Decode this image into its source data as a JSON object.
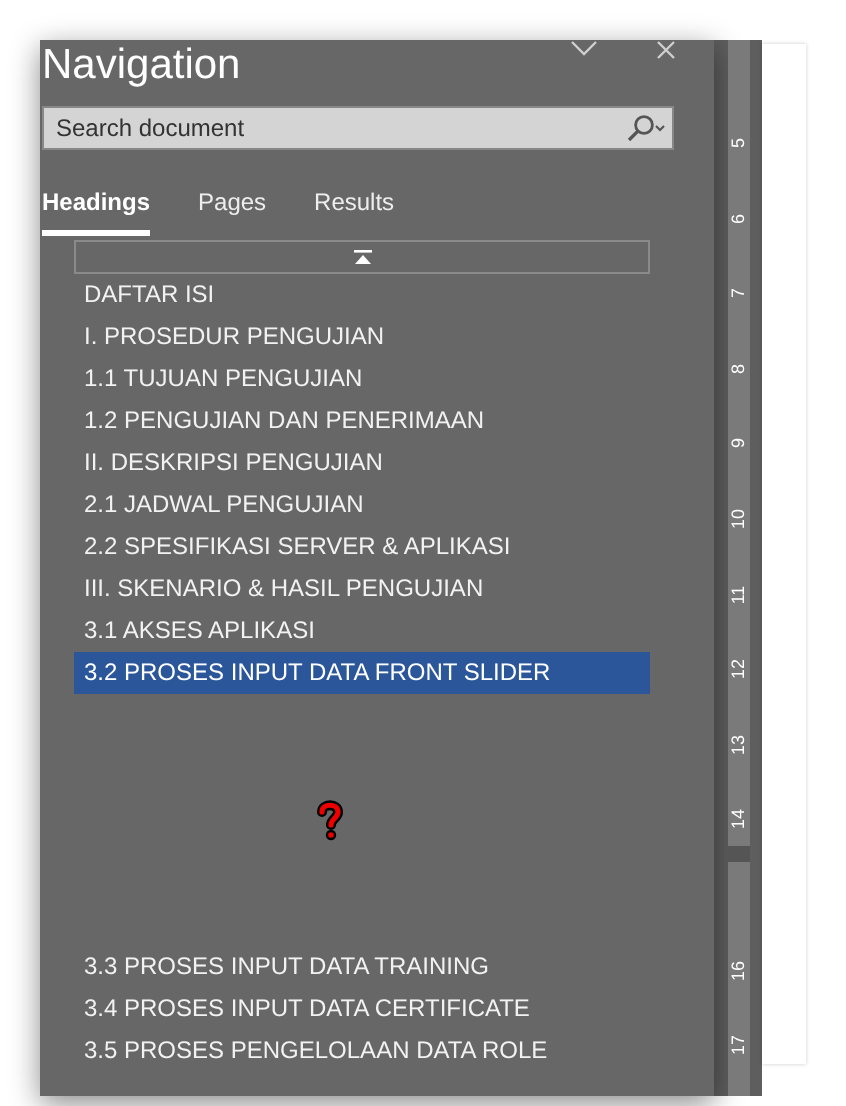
{
  "pane": {
    "title": "Navigation"
  },
  "search": {
    "placeholder": "Search document"
  },
  "tabs": [
    {
      "label": "Headings",
      "selected": true
    },
    {
      "label": "Pages",
      "selected": false
    },
    {
      "label": "Results",
      "selected": false
    }
  ],
  "headings": [
    {
      "label": "DAFTAR ISI",
      "selected": false
    },
    {
      "label": "I. PROSEDUR PENGUJIAN",
      "selected": false
    },
    {
      "label": "1.1 TUJUAN PENGUJIAN",
      "selected": false
    },
    {
      "label": "1.2 PENGUJIAN DAN PENERIMAAN",
      "selected": false
    },
    {
      "label": "II. DESKRIPSI PENGUJIAN",
      "selected": false
    },
    {
      "label": "2.1 JADWAL PENGUJIAN",
      "selected": false
    },
    {
      "label": "2.2 SPESIFIKASI SERVER & APLIKASI",
      "selected": false
    },
    {
      "label": "III. SKENARIO & HASIL PENGUJIAN",
      "selected": false
    },
    {
      "label": "3.1 AKSES APLIKASI",
      "selected": false
    },
    {
      "label": "3.2 PROSES INPUT DATA FRONT SLIDER",
      "selected": true
    }
  ],
  "headings_below": [
    {
      "label": "3.3 PROSES INPUT DATA TRAINING",
      "selected": false
    },
    {
      "label": "3.4 PROSES INPUT DATA CERTIFICATE",
      "selected": false
    },
    {
      "label": "3.5 PROSES PENGELOLAAN DATA ROLE",
      "selected": false
    }
  ],
  "ruler": {
    "labels": [
      "5",
      "6",
      "7",
      "8",
      "9",
      "10",
      "11",
      "12",
      "13",
      "14",
      "16",
      "17"
    ]
  }
}
